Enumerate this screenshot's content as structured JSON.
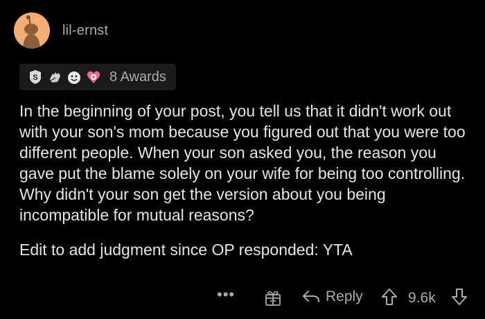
{
  "comment": {
    "username": "lil-ernst",
    "awards": {
      "count_label": "8 Awards",
      "icons": [
        "silver-award-icon",
        "hand-award-icon",
        "wholesome-award-icon",
        "heart-award-icon"
      ]
    },
    "paragraphs": [
      "In the beginning of your post, you tell us that it didn't work out with your son's mom because you figured out that you were too different people. When your son asked you, the reason you gave put the blame solely on your wife for being too controlling. Why didn't your son get the version about you being incompatible for mutual reasons?",
      "Edit to add judgment since OP responded: YTA"
    ]
  },
  "actions": {
    "more_label": "•••",
    "reply_label": "Reply",
    "vote_count": "9.6k"
  },
  "colors": {
    "background": "#000000",
    "text": "#e3e5e7",
    "muted": "#a9adb0",
    "avatar": "#f6ad72",
    "award_bar": "#1a1a1b"
  }
}
